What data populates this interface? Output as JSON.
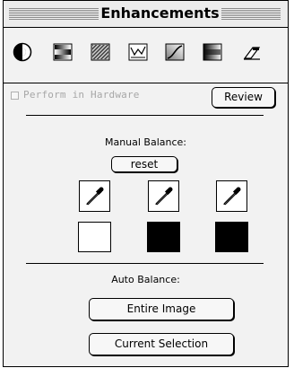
{
  "window": {
    "title": "Enhancements"
  },
  "toolbar": {
    "tools": [
      {
        "icon": "contrast-circle-icon"
      },
      {
        "icon": "gradient-bars-icon"
      },
      {
        "icon": "diagonal-texture-icon"
      },
      {
        "icon": "histogram-icon"
      },
      {
        "icon": "curve-graph-icon"
      },
      {
        "icon": "tonal-ramp-icon"
      },
      {
        "icon": "eraser-icon"
      }
    ]
  },
  "hardware": {
    "label": "Perform in Hardware",
    "checked": false
  },
  "review_button": "Review",
  "manual_balance": {
    "label": "Manual Balance:",
    "reset_button": "reset",
    "droppers": [
      "eyedropper-icon",
      "eyedropper-icon",
      "eyedropper-icon"
    ],
    "swatches": [
      {
        "color": "#ffffff"
      },
      {
        "color": "#000000"
      },
      {
        "color": "#000000"
      }
    ]
  },
  "auto_balance": {
    "label": "Auto Balance:",
    "entire_image_button": "Entire Image",
    "current_selection_button": "Current Selection"
  }
}
